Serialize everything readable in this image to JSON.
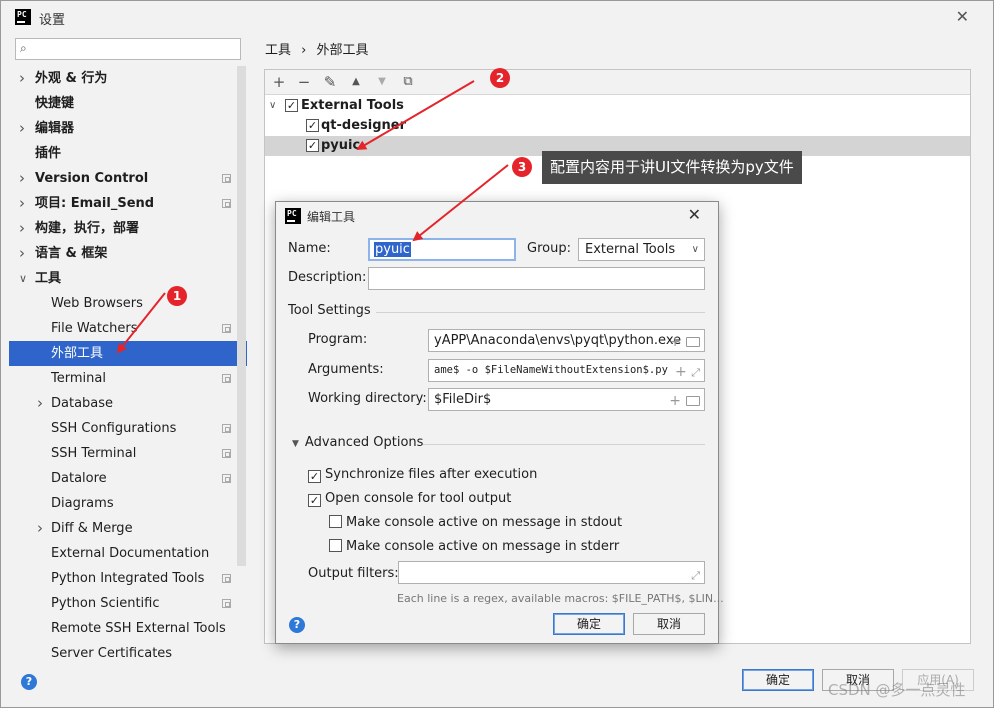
{
  "window": {
    "title": "设置",
    "logo_text": "PC"
  },
  "search": {
    "placeholder": ""
  },
  "sidebar": {
    "items": [
      {
        "label": "外观 & 行为",
        "level": 0,
        "expandable": true,
        "expanded": false
      },
      {
        "label": "快捷键",
        "level": 0
      },
      {
        "label": "编辑器",
        "level": 0,
        "expandable": true,
        "expanded": false
      },
      {
        "label": "插件",
        "level": 0
      },
      {
        "label": "Version Control",
        "level": 0,
        "expandable": true,
        "expanded": false,
        "project_icon": true
      },
      {
        "label": "项目: Email_Send",
        "level": 0,
        "expandable": true,
        "expanded": false,
        "project_icon": true
      },
      {
        "label": "构建，执行，部署",
        "level": 0,
        "expandable": true,
        "expanded": false
      },
      {
        "label": "语言 & 框架",
        "level": 0,
        "expandable": true,
        "expanded": false
      },
      {
        "label": "工具",
        "level": 0,
        "expandable": true,
        "expanded": true
      },
      {
        "label": "Web Browsers",
        "level": 1
      },
      {
        "label": "File Watchers",
        "level": 1,
        "project_icon": true
      },
      {
        "label": "外部工具",
        "level": 1,
        "selected": true
      },
      {
        "label": "Terminal",
        "level": 1,
        "project_icon": true
      },
      {
        "label": "Database",
        "level": 1,
        "expandable": true,
        "expanded": false
      },
      {
        "label": "SSH Configurations",
        "level": 1,
        "project_icon": true
      },
      {
        "label": "SSH Terminal",
        "level": 1,
        "project_icon": true
      },
      {
        "label": "Datalore",
        "level": 1,
        "project_icon": true
      },
      {
        "label": "Diagrams",
        "level": 1
      },
      {
        "label": "Diff & Merge",
        "level": 1,
        "expandable": true,
        "expanded": false
      },
      {
        "label": "External Documentation",
        "level": 1
      },
      {
        "label": "Python Integrated Tools",
        "level": 1,
        "project_icon": true
      },
      {
        "label": "Python Scientific",
        "level": 1,
        "project_icon": true
      },
      {
        "label": "Remote SSH External Tools",
        "level": 1
      },
      {
        "label": "Server Certificates",
        "level": 1
      }
    ]
  },
  "breadcrumb": {
    "parent": "工具",
    "separator": "›",
    "current": "外部工具"
  },
  "toolbar": {
    "add": "+",
    "remove": "−",
    "edit": "✎",
    "up": "▲",
    "down": "▼",
    "copy": "⧉"
  },
  "tools_tree": {
    "group_label": "External Tools",
    "items": [
      "qt-designer",
      "pyuic"
    ]
  },
  "footer": {
    "ok": "确定",
    "cancel": "取消",
    "apply": "应用(A)",
    "help": "?"
  },
  "dialog": {
    "title": "编辑工具",
    "name_label": "Name:",
    "name_value": "pyuic",
    "group_label": "Group:",
    "group_value": "External Tools",
    "description_label": "Description:",
    "description_value": "",
    "tool_settings_label": "Tool Settings",
    "program_label": "Program:",
    "program_value": "yAPP\\Anaconda\\envs\\pyqt\\python.exe",
    "arguments_label": "Arguments:",
    "arguments_value": "ame$ -o $FileNameWithoutExtension$.py",
    "workdir_label": "Working directory:",
    "workdir_value": "$FileDir$",
    "advanced_label": "Advanced Options",
    "sync_label": "Synchronize files after execution",
    "console_label": "Open console for tool output",
    "stdout_label": "Make console active on message in stdout",
    "stderr_label": "Make console active on message in stderr",
    "output_filters_label": "Output filters:",
    "output_filters_value": "",
    "hint": "Each line is a regex, available macros: $FILE_PATH$, $LIN...",
    "ok": "确定",
    "cancel": "取消",
    "help": "?"
  },
  "annotations": {
    "badge1": "1",
    "badge2": "2",
    "badge3": "3",
    "callout": "配置内容用于讲UI文件转换为py文件",
    "arrow_color": "#e4242a"
  },
  "watermark": "CSDN @多一点灵性"
}
